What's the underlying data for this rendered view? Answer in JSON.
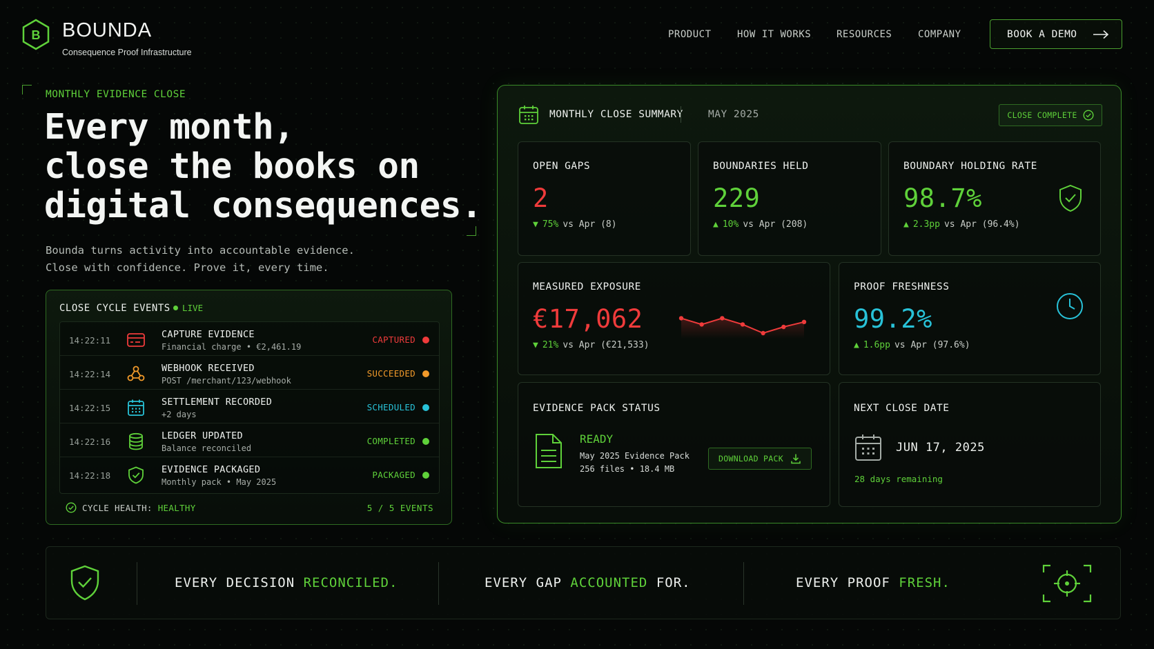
{
  "brand": {
    "name": "BOUNDA",
    "logo_letter": "B",
    "tagline": "Consequence Proof Infrastructure"
  },
  "nav": {
    "items": [
      "PRODUCT",
      "HOW IT WORKS",
      "RESOURCES",
      "COMPANY"
    ],
    "cta_label": "BOOK A DEMO"
  },
  "hero": {
    "eyebrow": "MONTHLY EVIDENCE CLOSE",
    "line1": "Every month,",
    "line2": "close the books on",
    "line3": "digital consequences.",
    "sub1": "Bounda turns activity into accountable evidence.",
    "sub2": "Close with confidence. Prove it, every time."
  },
  "events": {
    "title": "CLOSE CYCLE EVENTS",
    "live_label": "LIVE",
    "rows": [
      {
        "time": "14:22:11",
        "name": "CAPTURE EVIDENCE",
        "desc": "Financial charge • €2,461.19",
        "status": "CAPTURED",
        "icon": "card-icon"
      },
      {
        "time": "14:22:14",
        "name": "WEBHOOK RECEIVED",
        "desc": "POST /merchant/123/webhook",
        "status": "SUCCEEDED",
        "icon": "webhook-icon"
      },
      {
        "time": "14:22:15",
        "name": "SETTLEMENT RECORDED",
        "desc": "+2 days",
        "status": "SCHEDULED",
        "icon": "calendar-icon"
      },
      {
        "time": "14:22:16",
        "name": "LEDGER UPDATED",
        "desc": "Balance reconciled",
        "status": "COMPLETED",
        "icon": "database-icon"
      },
      {
        "time": "14:22:18",
        "name": "EVIDENCE PACKAGED",
        "desc": "Monthly pack • May 2025",
        "status": "PACKAGED",
        "icon": "shield-check-icon"
      }
    ],
    "health_label": "CYCLE HEALTH:",
    "health_value": "HEALTHY",
    "count": "5 / 5 EVENTS"
  },
  "summary": {
    "title": "MONTHLY CLOSE SUMMARY",
    "month": "MAY 2025",
    "badge": "CLOSE COMPLETE",
    "open_gaps": {
      "label": "OPEN GAPS",
      "value": "2",
      "delta": "75%",
      "compare": "vs Apr (8)"
    },
    "boundaries_held": {
      "label": "BOUNDARIES HELD",
      "value": "229",
      "delta": "10%",
      "compare": "vs Apr (208)"
    },
    "holding_rate": {
      "label": "BOUNDARY HOLDING RATE",
      "value": "98.7%",
      "delta": "2.3pp",
      "compare": "vs Apr (96.4%)"
    },
    "exposure": {
      "label": "MEASURED EXPOSURE",
      "value": "€17,062",
      "delta": "21%",
      "compare": "vs Apr (€21,533)"
    },
    "freshness": {
      "label": "PROOF FRESHNESS",
      "value": "99.2%",
      "delta": "1.6pp",
      "compare": "vs Apr (97.6%)"
    },
    "pack": {
      "label": "EVIDENCE PACK STATUS",
      "status": "READY",
      "name": "May 2025 Evidence Pack",
      "meta": "256 files • 18.4 MB",
      "download": "DOWNLOAD PACK"
    },
    "next_close": {
      "label": "NEXT CLOSE DATE",
      "date": "JUN 17, 2025",
      "remaining": "28 days remaining"
    }
  },
  "sparkline": {
    "values": [
      0.6,
      0.35,
      0.6,
      0.35,
      0.0,
      0.25,
      0.45
    ]
  },
  "strip": {
    "s1a": "EVERY DECISION",
    "s1b": "RECONCILED.",
    "s2a": "EVERY GAP",
    "s2b": "ACCOUNTED",
    "s2c": "FOR.",
    "s3a": "EVERY PROOF",
    "s3b": "FRESH."
  },
  "colors": {
    "accent": "#5fd13a",
    "danger": "#ef3b3b",
    "warning": "#f29a2a",
    "info": "#28c2d8"
  }
}
